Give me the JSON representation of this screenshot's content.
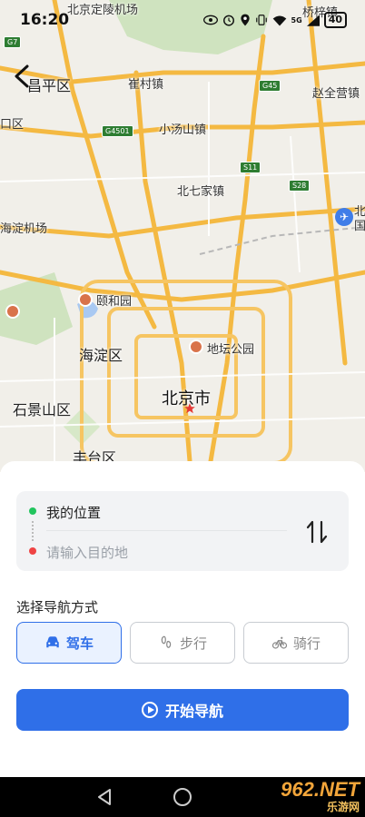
{
  "status_bar": {
    "time": "16:20",
    "network": "5G",
    "battery": "40",
    "icons": [
      "eye-icon",
      "alarm-icon",
      "location-icon",
      "vibrate-icon",
      "wifi-icon",
      "signal-icon",
      "battery-icon"
    ]
  },
  "map": {
    "labels": {
      "changping": "昌平区",
      "cuicun": "崔村镇",
      "xiaotangshan": "小汤山镇",
      "beiqijia": "北七家镇",
      "zhaoquanying": "赵全营镇",
      "haidian_airport": "海淀机场",
      "yiheyuan": "颐和园",
      "haidian": "海淀区",
      "ditan": "地坛公园",
      "shijingshan": "石景山区",
      "beijing": "北京市",
      "fengtai": "丰台区",
      "kou": "口区",
      "qiaozi": "桥梓镇",
      "dingling": "北京定陵机场",
      "bei": "北",
      "guo": "国"
    },
    "shields": {
      "g45": "G45",
      "g4501": "G4501",
      "s11": "S11",
      "s28": "S28",
      "g7": "G7"
    }
  },
  "route": {
    "from": "我的位置",
    "to_placeholder": "请输入目的地"
  },
  "mode_section": {
    "title": "选择导航方式",
    "modes": [
      {
        "label": "驾车",
        "icon": "car-icon",
        "active": true
      },
      {
        "label": "步行",
        "icon": "footprint-icon",
        "active": false
      },
      {
        "label": "骑行",
        "icon": "bicycle-icon",
        "active": false
      }
    ]
  },
  "start_button": {
    "label": "开始导航"
  },
  "watermark": {
    "main": "962.NET",
    "sub": "乐游网"
  },
  "colors": {
    "accent": "#2f6fe8",
    "from_dot": "#22c55e",
    "to_dot": "#ef4444",
    "road": "#f4b942"
  }
}
